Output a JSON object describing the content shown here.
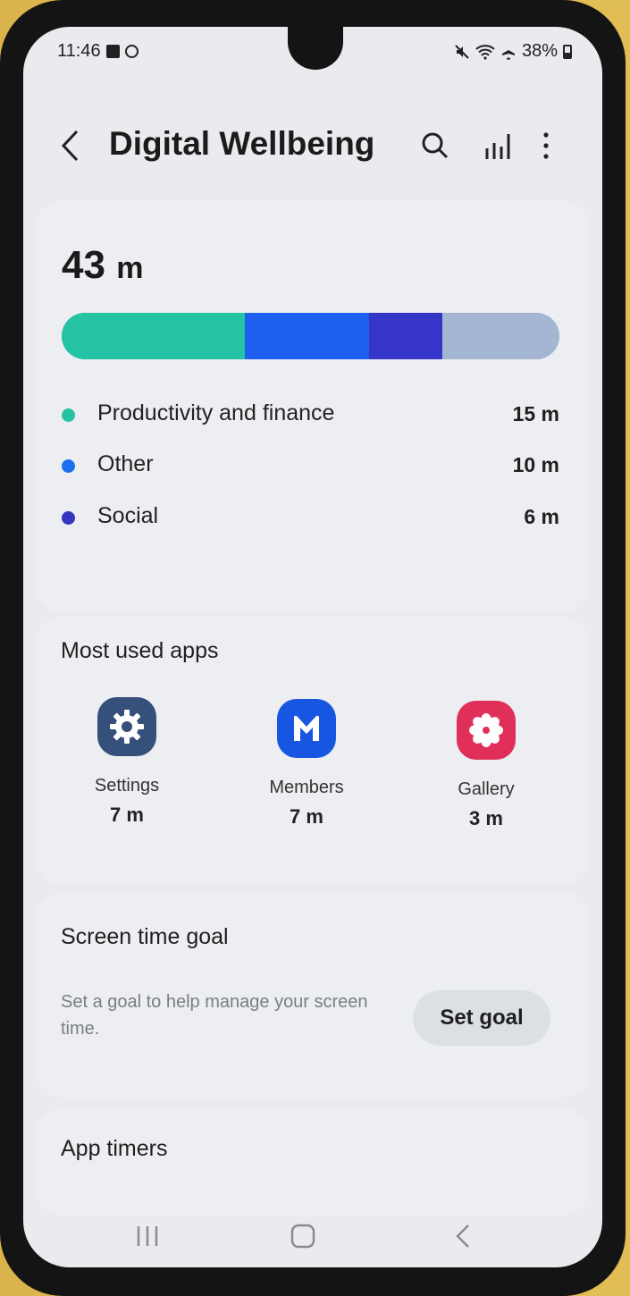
{
  "status_bar": {
    "time": "11:46",
    "battery": "38%"
  },
  "header": {
    "title": "Digital Wellbeing"
  },
  "icons": {
    "back": "back-arrow-icon",
    "search": "search-icon",
    "stats": "bar-chart-icon",
    "more": "more-vert-icon"
  },
  "usage": {
    "total_value": "43",
    "total_unit": "m",
    "bar_fractions": [
      0.368,
      0.25,
      0.147,
      0.235
    ],
    "bar_colors": [
      "#23c3a4",
      "#1e5ff0",
      "#3535c8",
      "#a5b6d2"
    ],
    "categories": [
      {
        "name": "Productivity and finance",
        "time": "15 m",
        "color": "#23c3a4"
      },
      {
        "name": "Other",
        "time": "10 m",
        "color": "#1e6ff0"
      },
      {
        "name": "Social",
        "time": "6 m",
        "color": "#3535c0"
      }
    ]
  },
  "most_used": {
    "title": "Most used apps",
    "apps": [
      {
        "name": "Settings",
        "time": "7 m",
        "icon": "settings-gear-icon",
        "color": "#35507a"
      },
      {
        "name": "Members",
        "time": "7 m",
        "icon": "members-m-icon",
        "color": "#1656e0"
      },
      {
        "name": "Gallery",
        "time": "3 m",
        "icon": "gallery-flower-icon",
        "color": "#e0305a"
      }
    ]
  },
  "screen_time_goal": {
    "title": "Screen time goal",
    "description": "Set a goal to help manage your screen time.",
    "button_label": "Set goal"
  },
  "app_timers": {
    "title": "App timers"
  }
}
